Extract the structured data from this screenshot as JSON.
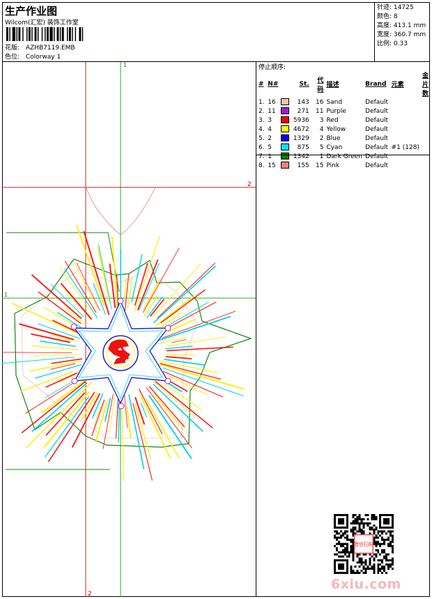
{
  "header": {
    "title": "生产作业图",
    "company": "Wilcom(汇宏) 装饰工作室",
    "design_label": "花版:",
    "design_file": "AZHB7119.EMB",
    "colorway_label": "色位:",
    "colorway": "Colorway 1"
  },
  "stats": [
    {
      "label": "针迹:",
      "value": "14725"
    },
    {
      "label": "颜色:",
      "value": "8"
    },
    {
      "label": "高度:",
      "value": "413.1 mm"
    },
    {
      "label": "宽度:",
      "value": "360.7 mm"
    },
    {
      "label": "比例:",
      "value": "0.33"
    }
  ],
  "stop_sequence": {
    "title": "停止顺序:",
    "headers": [
      "#",
      "N#",
      "St.",
      "代码",
      "描述",
      "Brand",
      "元素",
      "金片数"
    ],
    "rows": [
      {
        "num": "1.",
        "n": "16",
        "color": "#e8c4b0",
        "st": "143",
        "code": "16",
        "desc": "Sand",
        "brand": "Default",
        "elem": "",
        "seq": ""
      },
      {
        "num": "2.",
        "n": "11",
        "color": "#9b1fcf",
        "st": "271",
        "code": "11",
        "desc": "Purple",
        "brand": "Default",
        "elem": "",
        "seq": ""
      },
      {
        "num": "3.",
        "n": "3",
        "color": "#ff0000",
        "st": "5936",
        "code": "3",
        "desc": "Red",
        "brand": "Default",
        "elem": "",
        "seq": ""
      },
      {
        "num": "4.",
        "n": "4",
        "color": "#ffff00",
        "st": "4672",
        "code": "4",
        "desc": "Yellow",
        "brand": "Default",
        "elem": "",
        "seq": ""
      },
      {
        "num": "5.",
        "n": "2",
        "color": "#0000ff",
        "st": "1329",
        "code": "2",
        "desc": "Blue",
        "brand": "Default",
        "elem": "",
        "seq": ""
      },
      {
        "num": "6.",
        "n": "5",
        "color": "#00e5ee",
        "st": "875",
        "code": "5",
        "desc": "Cyan",
        "brand": "Default",
        "elem": "#1 (128)",
        "seq": ""
      },
      {
        "num": "7.",
        "n": "1",
        "color": "#008000",
        "st": "1342",
        "code": "1",
        "desc": "Dark Green",
        "brand": "Default",
        "elem": "",
        "seq": ""
      },
      {
        "num": "8.",
        "n": "15",
        "color": "#f08080",
        "st": "155",
        "code": "15",
        "desc": "Pink",
        "brand": "Default",
        "elem": "",
        "seq": ""
      }
    ]
  },
  "guides": {
    "top_label": "1",
    "bottom_label": "2",
    "left_label": "1",
    "right_label": "2"
  },
  "watermark": "6xiu.com",
  "seal_text": "微信扫码"
}
